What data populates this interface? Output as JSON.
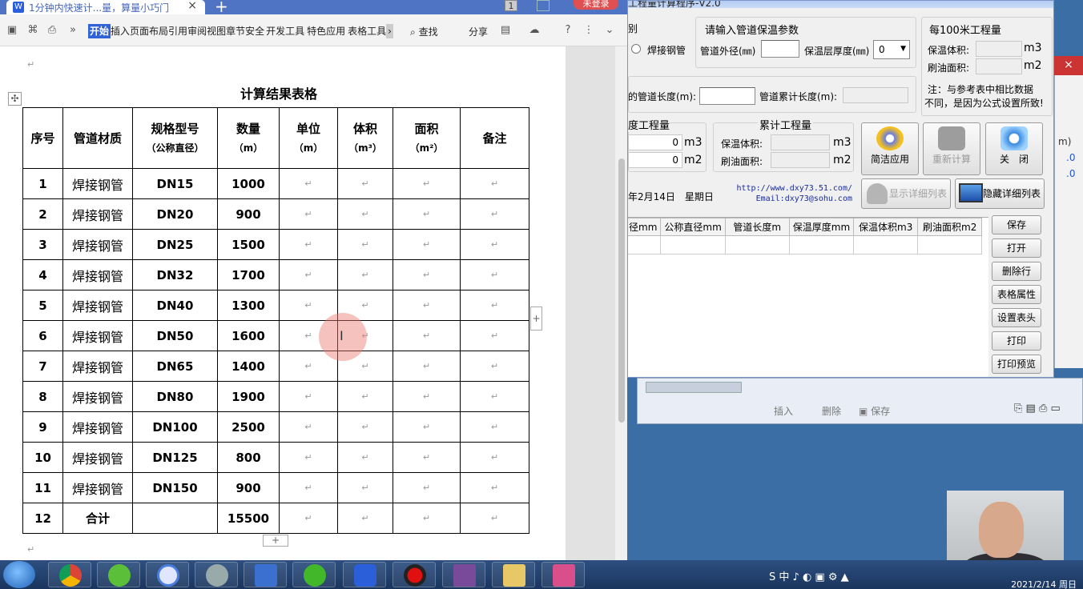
{
  "wps": {
    "tab_title": "1分钟内快速计...量，算量小巧门",
    "tab_close": "×",
    "new_tab": "+",
    "page_count": "1",
    "login": "未登录",
    "menu": [
      "开始",
      "插入",
      "页面布局",
      "引用",
      "审阅",
      "视图",
      "章节",
      "安全",
      "开发工具",
      "特色应用",
      "表格工具"
    ],
    "find": "查找",
    "share": "分享",
    "more": "»",
    "overflow": "›"
  },
  "doc": {
    "para_mark": "↵",
    "table_title": "计算结果表格",
    "headers": [
      {
        "l1": "序号",
        "l2": ""
      },
      {
        "l1": "管道材质",
        "l2": ""
      },
      {
        "l1": "规格型号",
        "l2": "（公称直径）"
      },
      {
        "l1": "数量",
        "l2": "（m）"
      },
      {
        "l1": "单位",
        "l2": "（m）"
      },
      {
        "l1": "体积",
        "l2": "（m³）"
      },
      {
        "l1": "面积",
        "l2": "（m²）"
      },
      {
        "l1": "备注",
        "l2": ""
      }
    ],
    "rows": [
      [
        "1",
        "焊接钢管",
        "DN15",
        "1000"
      ],
      [
        "2",
        "焊接钢管",
        "DN20",
        "900"
      ],
      [
        "3",
        "焊接钢管",
        "DN25",
        "1500"
      ],
      [
        "4",
        "焊接钢管",
        "DN32",
        "1700"
      ],
      [
        "5",
        "焊接钢管",
        "DN40",
        "1300"
      ],
      [
        "6",
        "焊接钢管",
        "DN50",
        "1600"
      ],
      [
        "7",
        "焊接钢管",
        "DN65",
        "1400"
      ],
      [
        "8",
        "焊接钢管",
        "DN80",
        "1900"
      ],
      [
        "9",
        "焊接钢管",
        "DN100",
        "2500"
      ],
      [
        "10",
        "焊接钢管",
        "DN125",
        "800"
      ],
      [
        "11",
        "焊接钢管",
        "DN150",
        "900"
      ],
      [
        "12",
        "合计",
        "",
        "15500"
      ]
    ],
    "add_row": "+",
    "add_col": "+"
  },
  "calc": {
    "title": "工程量计算程序-V2.0",
    "type_label": "别",
    "radio_label": "焊接钢管",
    "param_title": "请输入管道保温参数",
    "outer_diameter_label": "管道外径(㎜)",
    "insul_thickness_label": "保温层厚度(㎜)",
    "insul_thickness_value": "0",
    "pipe_length_label": "的管道长度(m):",
    "cum_length_label": "管道累计长度(m):",
    "per100_title": "每100米工程量",
    "insul_volume_label": "保温体积:",
    "paint_area_label": "刷油面积:",
    "unit_m3": "m3",
    "unit_m2": "m2",
    "note": "注：与参考表中相比数据",
    "note2": "不同，是因为公式设置所致!",
    "section_qty_title": "度工程量",
    "section_qty_v1": "0",
    "section_qty_v2": "0",
    "cum_qty_title": "累计工程量",
    "date_text": "年2月14日　星期日",
    "url1": "http://www.dxy73.51.com/",
    "url2": "Email:dxy73@sohu.com",
    "btn_apply": "简洁应用",
    "btn_recalc": "重新计算",
    "btn_close": "关　闭",
    "btn_show_detail": "显示详细列表",
    "btn_hide_detail": "隐藏详细列表",
    "grid_headers": [
      "径mm",
      "公称直径mm",
      "管道长度m",
      "保温厚度mm",
      "保温体积m3",
      "刷油面积m2"
    ],
    "side_buttons": [
      "保存",
      "打开",
      "删除行",
      "表格属性",
      "设置表头",
      "打印",
      "打印预览"
    ]
  },
  "bg": {
    "insert": "插入",
    "delete": "删除",
    "save": "保存",
    "close": "×",
    "col_fragment": "m)",
    "val_fragment": ".0"
  },
  "taskbar": {
    "clock_time": "2021/2/14 周日",
    "tray_text": "S 中 ♪ ◐ ▣ ⚙ ▲"
  }
}
